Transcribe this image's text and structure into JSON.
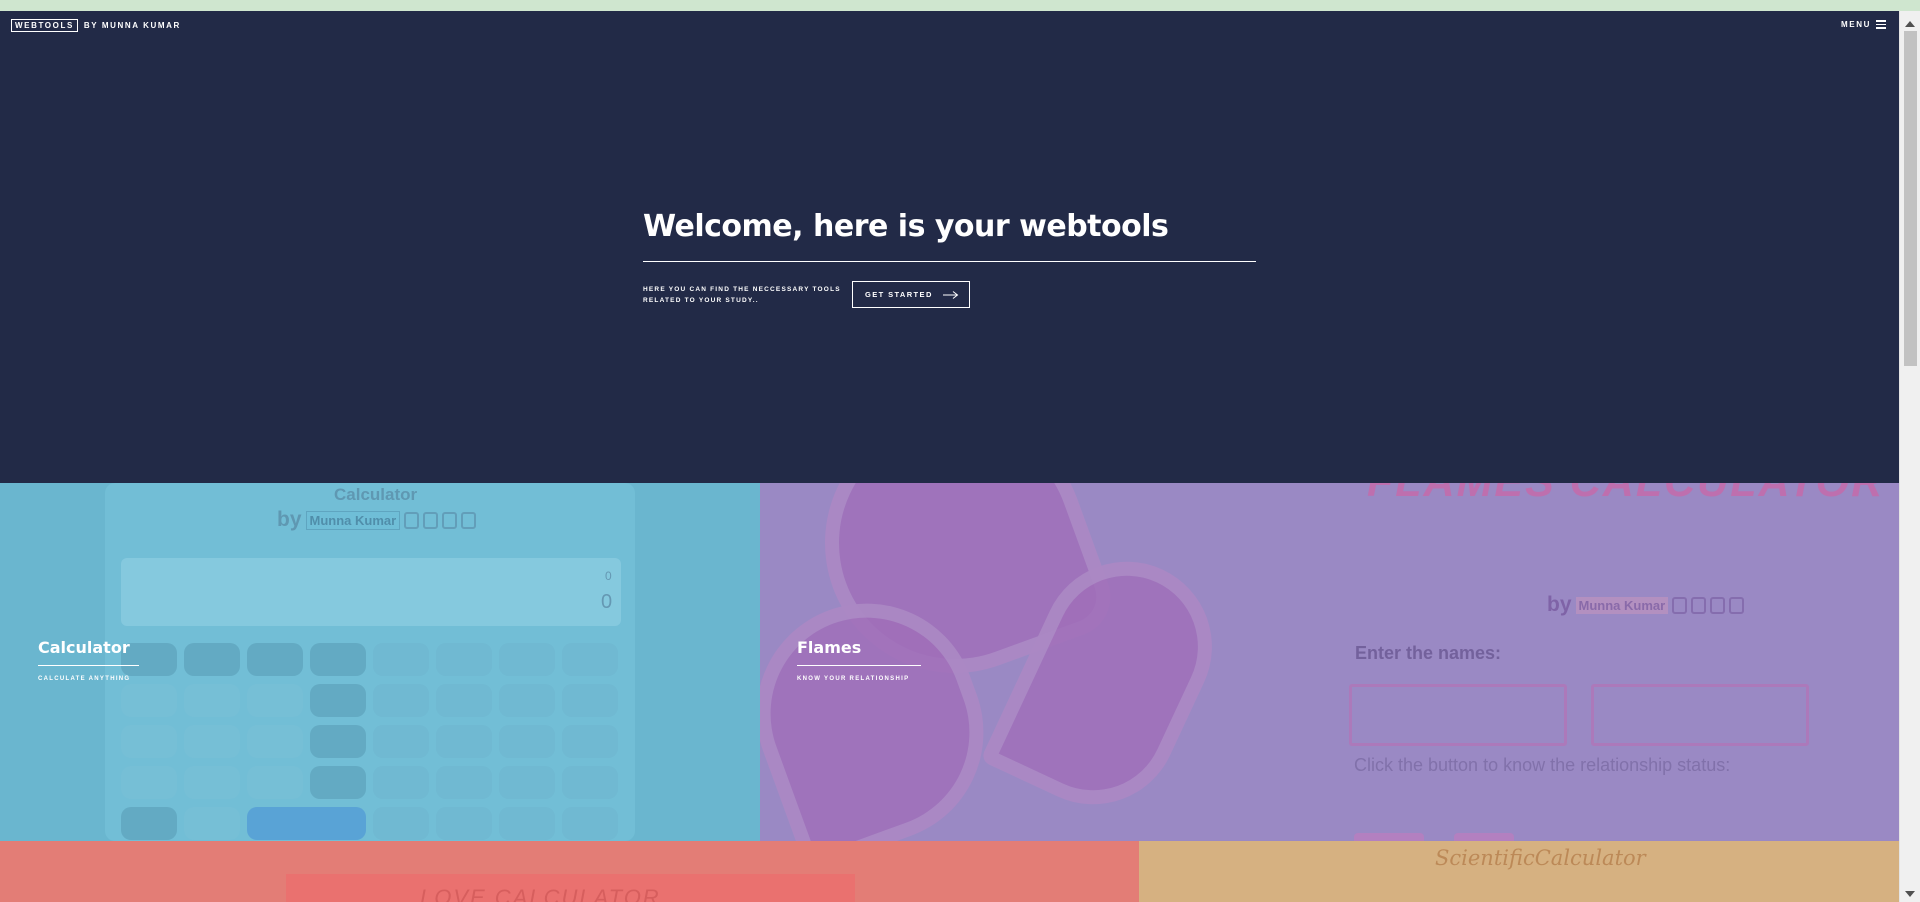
{
  "header": {
    "logo_box": "WEBTOOLS",
    "logo_by": "BY MUNNA KUMAR",
    "menu_label": "MENU"
  },
  "hero": {
    "title": "Welcome, here is your webtools",
    "subtitle": "HERE YOU CAN FIND THE NECCESSARY TOOLS RELATED TO YOUR STUDY..",
    "cta_label": "GET STARTED"
  },
  "cards": {
    "calculator": {
      "title": "Calculator",
      "subtitle": "CALCULATE ANYTHING",
      "preview": {
        "title": "Calculator",
        "by": "by",
        "author": "Munna Kumar",
        "display_top": "0",
        "display_main": "0"
      }
    },
    "flames": {
      "title": "Flames",
      "subtitle": "KNOW YOUR RELATIONSHIP",
      "preview": {
        "title": "FLAMES CALCULATOR",
        "by": "by",
        "author": "Munna Kumar",
        "label": "Enter the names:",
        "hint": "Click the button to know the relationship status:"
      }
    },
    "love": {
      "preview_title": "LOVE CALCULATOR"
    },
    "scientific": {
      "preview_title": "ScientificCalculator"
    }
  },
  "colors": {
    "hero_bg": "#222a47",
    "calculator_bg": "#6ab6cf",
    "flames_bg": "#9a89c4",
    "love_bg": "#e37d76",
    "scientific_bg": "#d6b181"
  },
  "icons": [
    "menu-icon",
    "arrow-right-icon",
    "facebook-icon",
    "linkedin-icon",
    "instagram-icon",
    "github-icon"
  ]
}
